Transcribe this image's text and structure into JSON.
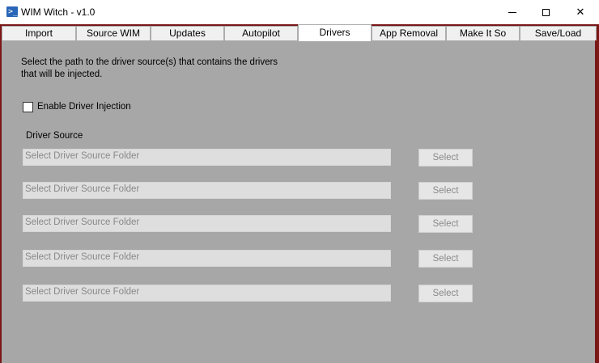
{
  "window": {
    "title": "WIM Witch - v1.0",
    "icon": "powershell-icon",
    "controls": {
      "minimize": "minimize-icon",
      "maximize": "maximize-icon",
      "close": "✕"
    }
  },
  "tabs": [
    {
      "label": "Import"
    },
    {
      "label": "Source WIM"
    },
    {
      "label": "Updates"
    },
    {
      "label": "Autopilot"
    },
    {
      "label": "Drivers",
      "active": true
    },
    {
      "label": "App Removal"
    },
    {
      "label": "Make It So"
    },
    {
      "label": "Save/Load"
    }
  ],
  "drivers": {
    "description": "Select the path to the driver source(s) that contains the drivers that will be injected.",
    "enable_checkbox": {
      "label": "Enable Driver Injection",
      "checked": false
    },
    "section_label": "Driver Source",
    "sources": [
      {
        "value": "Select Driver Source Folder",
        "button": "Select"
      },
      {
        "value": "Select Driver Source Folder",
        "button": "Select"
      },
      {
        "value": "Select Driver Source Folder",
        "button": "Select"
      },
      {
        "value": "Select Driver Source Folder",
        "button": "Select"
      },
      {
        "value": "Select Driver Source Folder",
        "button": "Select"
      }
    ]
  },
  "colors": {
    "frame": "#7a1717",
    "content_bg": "#a7a7a7",
    "accent_icon": "#2a66b8"
  }
}
